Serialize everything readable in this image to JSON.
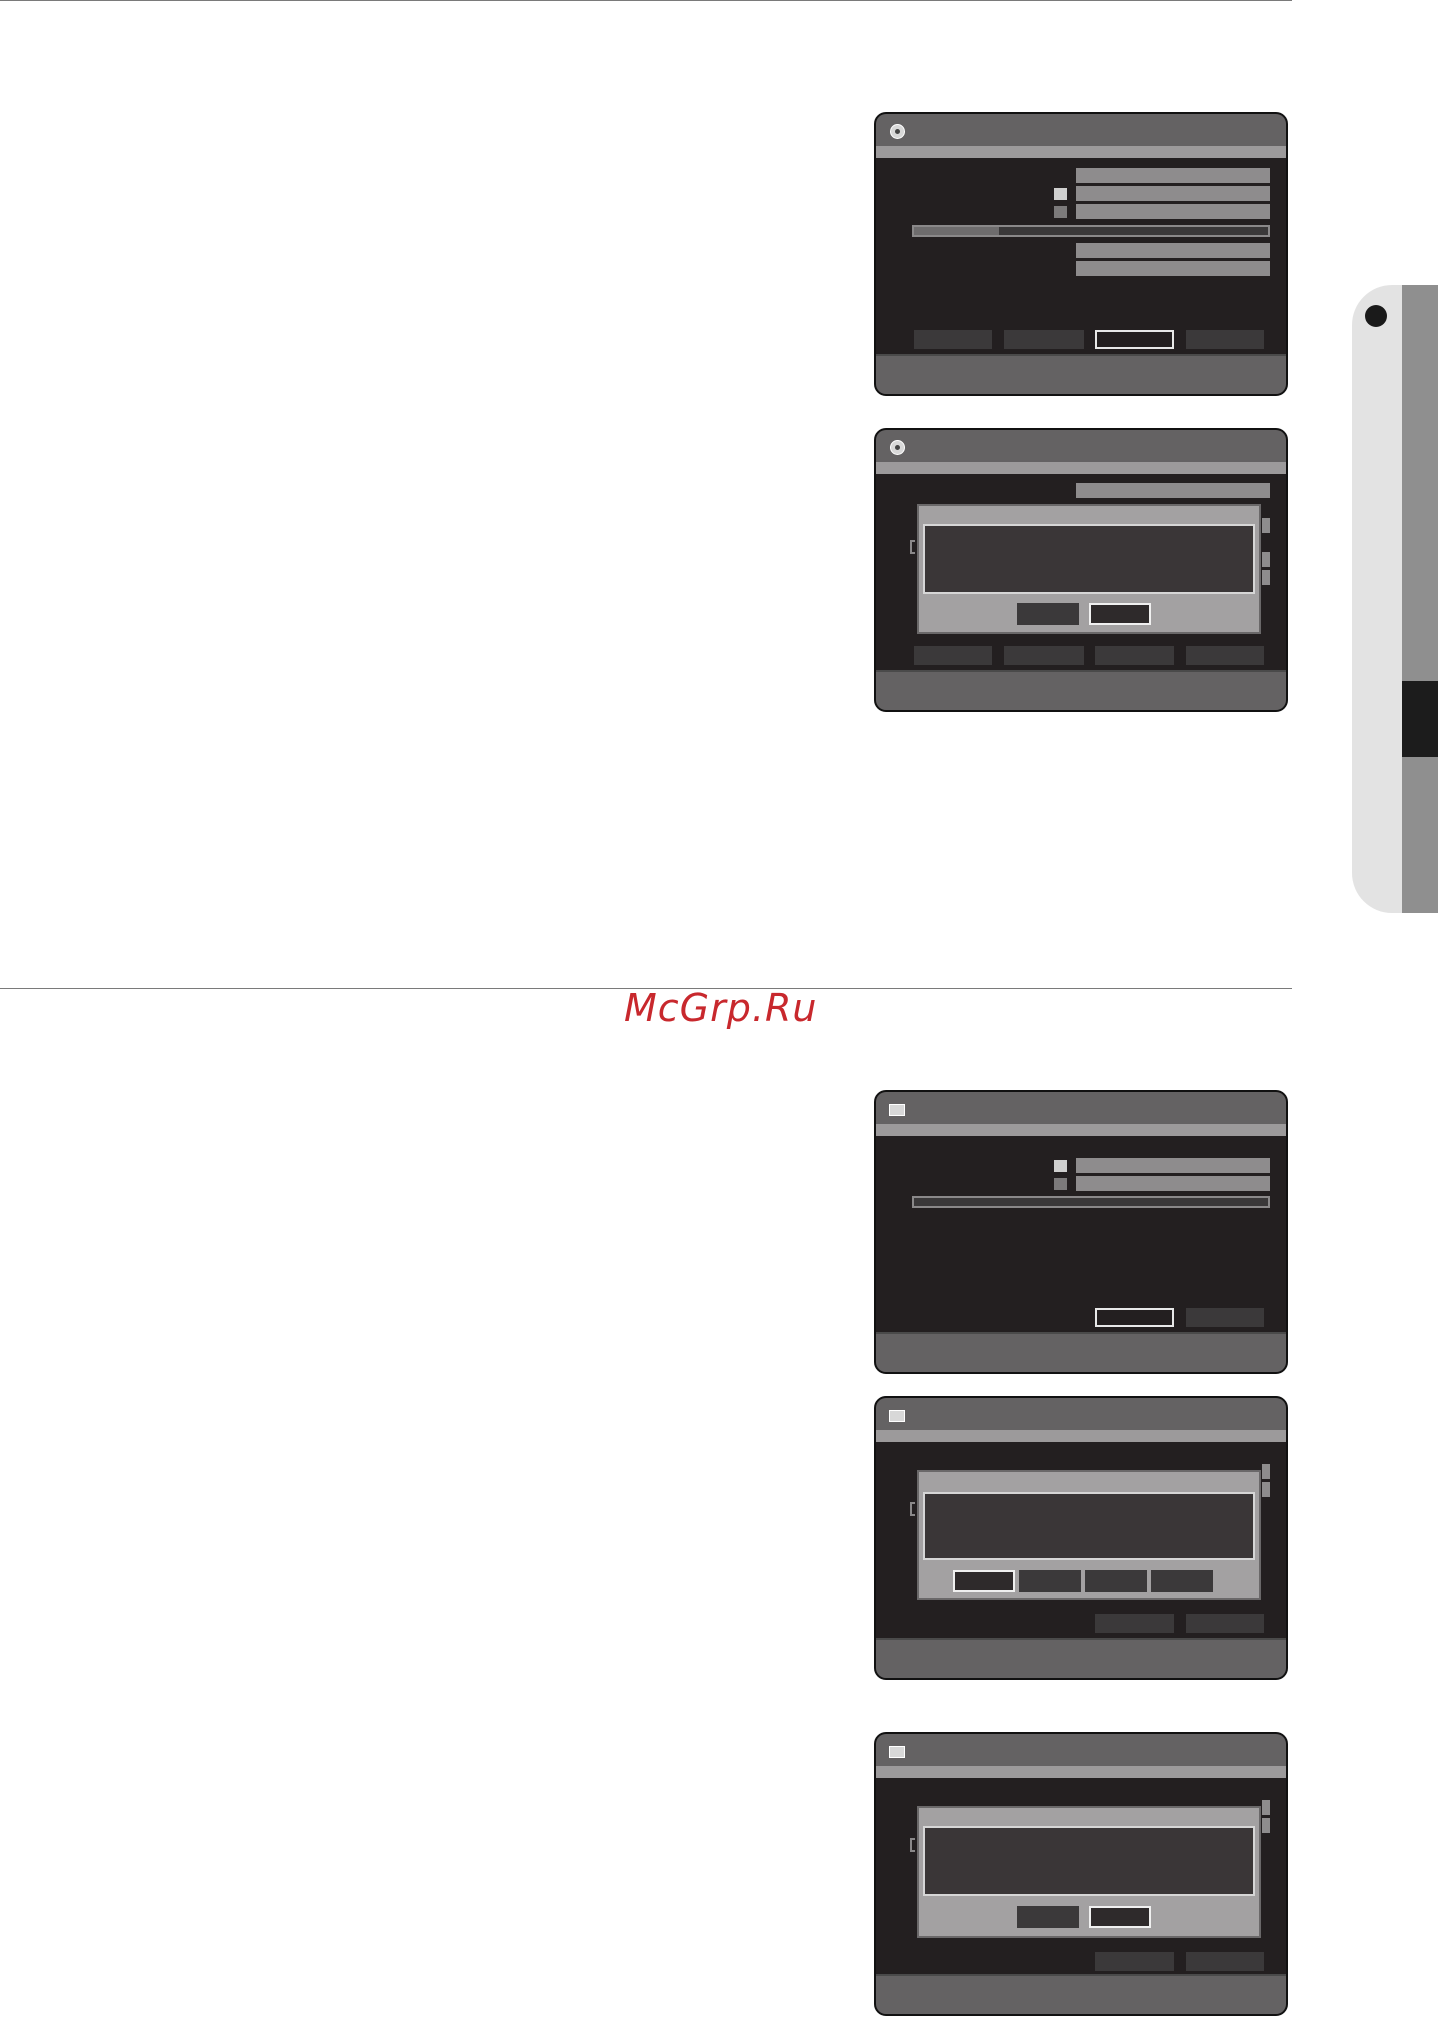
{
  "watermark": "McGrp.Ru",
  "screens": [
    {
      "id": "screen-1",
      "icon": "disc-icon"
    },
    {
      "id": "screen-2",
      "icon": "disc-icon"
    },
    {
      "id": "screen-3",
      "icon": "hdd-icon"
    },
    {
      "id": "screen-4",
      "icon": "hdd-icon"
    },
    {
      "id": "screen-5",
      "icon": "hdd-icon"
    }
  ],
  "progress": {
    "screen-1": 0.24
  },
  "colors": {
    "watermark": "#c8282d",
    "screen_bg": "#231f20",
    "bar": "#646263"
  }
}
